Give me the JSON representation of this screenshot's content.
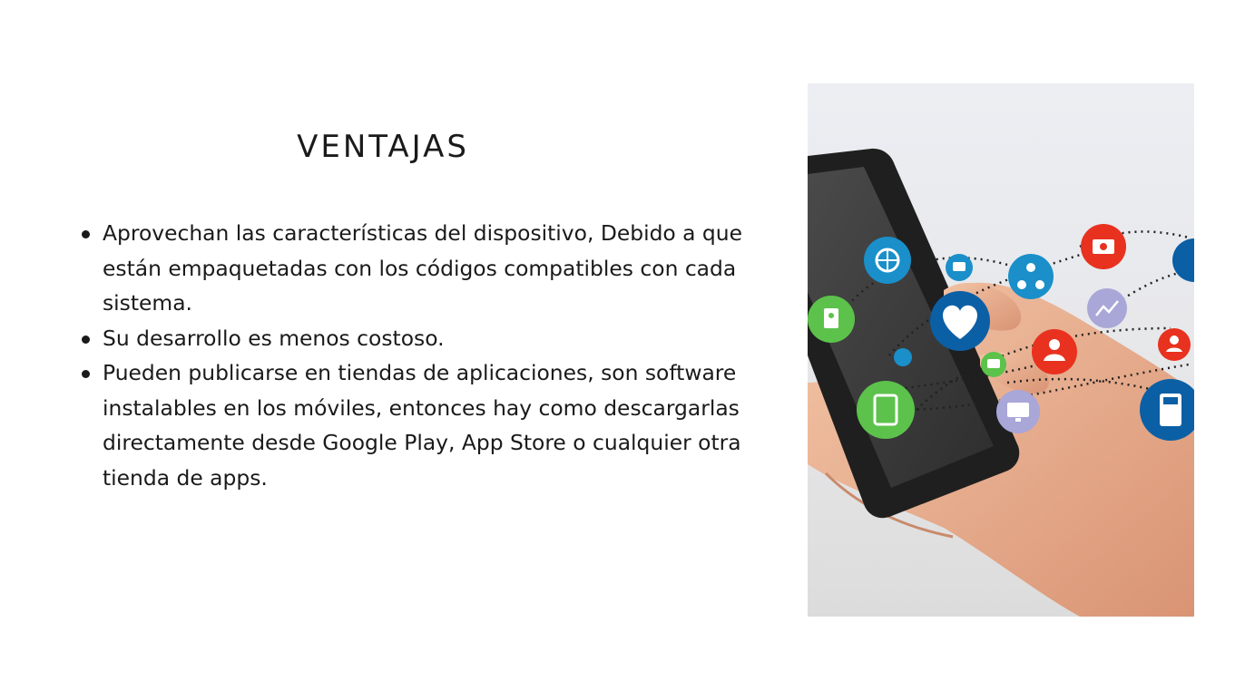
{
  "slide": {
    "title": "VENTAJAS",
    "bullets": [
      "Aprovechan las características del dispositivo, Debido a que están empaquetadas con los códigos compatibles con cada sistema.",
      "Su desarrollo es menos costoso.",
      "Pueden publicarse en tiendas de aplicaciones, son software instalables en los móviles, entonces hay como descargarlas directamente desde Google Play, App Store o cualquier otra tienda de apps."
    ]
  },
  "photo": {
    "icons": [
      "globe-icon",
      "chat-icon",
      "network-icon",
      "mail-icon",
      "contact-icon",
      "heart-icon",
      "chart-icon",
      "user-icon",
      "dot-icon",
      "message-icon",
      "tablet-icon",
      "monitor-icon",
      "calculator-icon",
      "person-icon"
    ],
    "colors": {
      "blue": "#1a8fc9",
      "dark_blue": "#0b5fa5",
      "green": "#5cc24b",
      "red": "#e8321f",
      "lavender": "#a9a6d8",
      "phone": "#2b2b2b"
    }
  }
}
